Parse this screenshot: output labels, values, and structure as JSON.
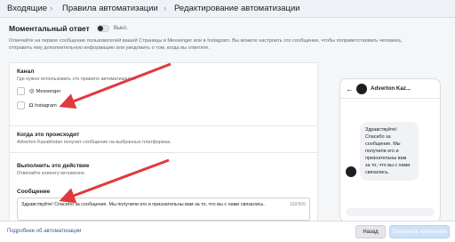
{
  "breadcrumbs": [
    "Входящие",
    "Правила автоматизации",
    "Редактирование автоматизации"
  ],
  "instant_reply": {
    "title": "Моментальный ответ",
    "toggle_label": "Выкл."
  },
  "description": "Отвечайте на первое сообщение пользователей вашей Страницы в Messenger или в Instagram. Вы можете настроить это сообщение, чтобы поприветствовать человека, отправить ему дополнительную информацию или уведомить о том, когда вы ответите.",
  "channel": {
    "title": "Канал",
    "subtitle": "Где нужно использовать это правило автоматизации?",
    "options": [
      {
        "label": "Messenger",
        "icon": "messenger-icon",
        "glyph": "◎"
      },
      {
        "label": "Instagram",
        "icon": "instagram-icon",
        "glyph": "◘"
      }
    ]
  },
  "when": {
    "title": "Когда это происходит",
    "subtitle": "Adverton Kazakhstan получит сообщение на выбранных платформах."
  },
  "action": {
    "title": "Выполнить это действие",
    "subtitle": "Отвечайте клиенту мгновенно."
  },
  "message": {
    "title": "Сообщение",
    "value": "Здравствуйте! Спасибо за сообщение. Мы получили его и признательны вам за то, что вы с нами связались.",
    "counter": "102/500"
  },
  "preview": {
    "page_name": "Adverton Kaz...",
    "bubble": "Здравствуйте!\nСпасибо за\nсообщение. Мы\nполучили его и\nпризнательны вам\nза то, что вы с нами\nсвязались."
  },
  "footer": {
    "link": "Подробнее об автоматизации",
    "back": "Назад",
    "save": "Сохранить изменения"
  },
  "colors": {
    "arrow": "#e0393e",
    "link": "#385898",
    "save_button": "#cde1f8"
  }
}
